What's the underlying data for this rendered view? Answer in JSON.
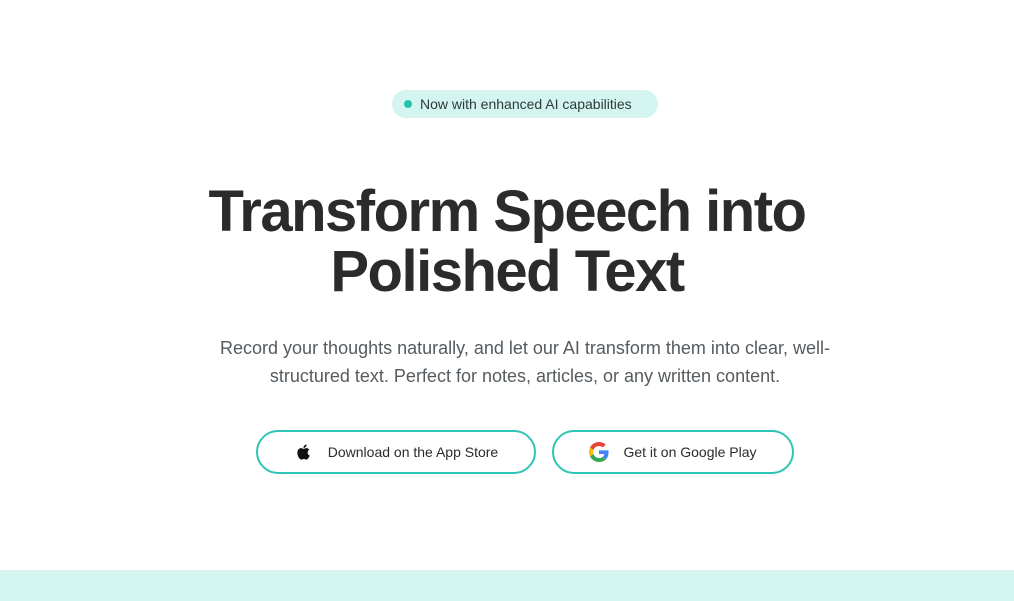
{
  "badge": {
    "text": "Now with enhanced AI capabilities"
  },
  "hero": {
    "title_line1": "Transform Speech into",
    "title_line2": "Polished Text",
    "subtitle": "Record your thoughts naturally, and let our AI transform them into clear, well-structured text. Perfect for notes, articles, or any written content."
  },
  "buttons": {
    "app_store": {
      "label": "Download on the App Store",
      "icon": "apple-icon"
    },
    "google_play": {
      "label": "Get it on Google Play",
      "icon": "google-icon"
    }
  },
  "colors": {
    "accent": "#2ec5b6",
    "badge_bg": "#d3f4ef",
    "badge_dot": "#22c3ae",
    "text_dark": "#2b2b2b",
    "text_muted": "#555b5f"
  }
}
